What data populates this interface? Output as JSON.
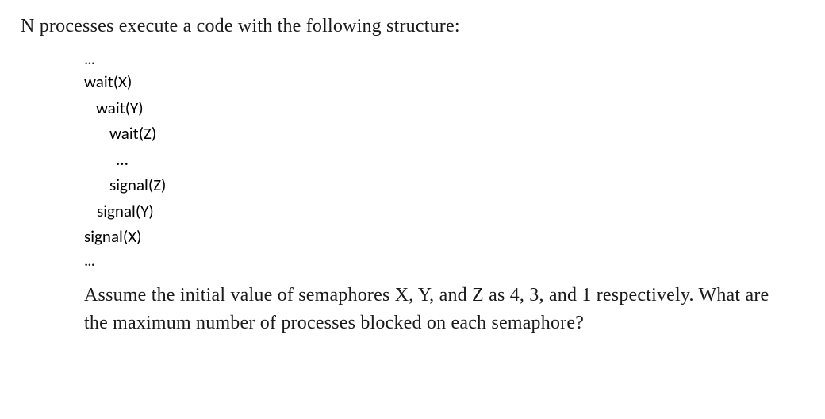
{
  "intro": "N processes execute a code with the following structure:",
  "ellipsis_top": "...",
  "code": {
    "l1": "wait(X)",
    "l2": "wait(Y)",
    "l3": "wait(Z)",
    "l4": "...",
    "l5": "signal(Z)",
    "l6": "signal(Y)",
    "l7": "signal(X)"
  },
  "ellipsis_bottom": "...",
  "question": "Assume the initial value of semaphores X, Y, and Z as 4, 3, and 1 respectively. What are the maximum number of processes blocked on each semaphore?"
}
